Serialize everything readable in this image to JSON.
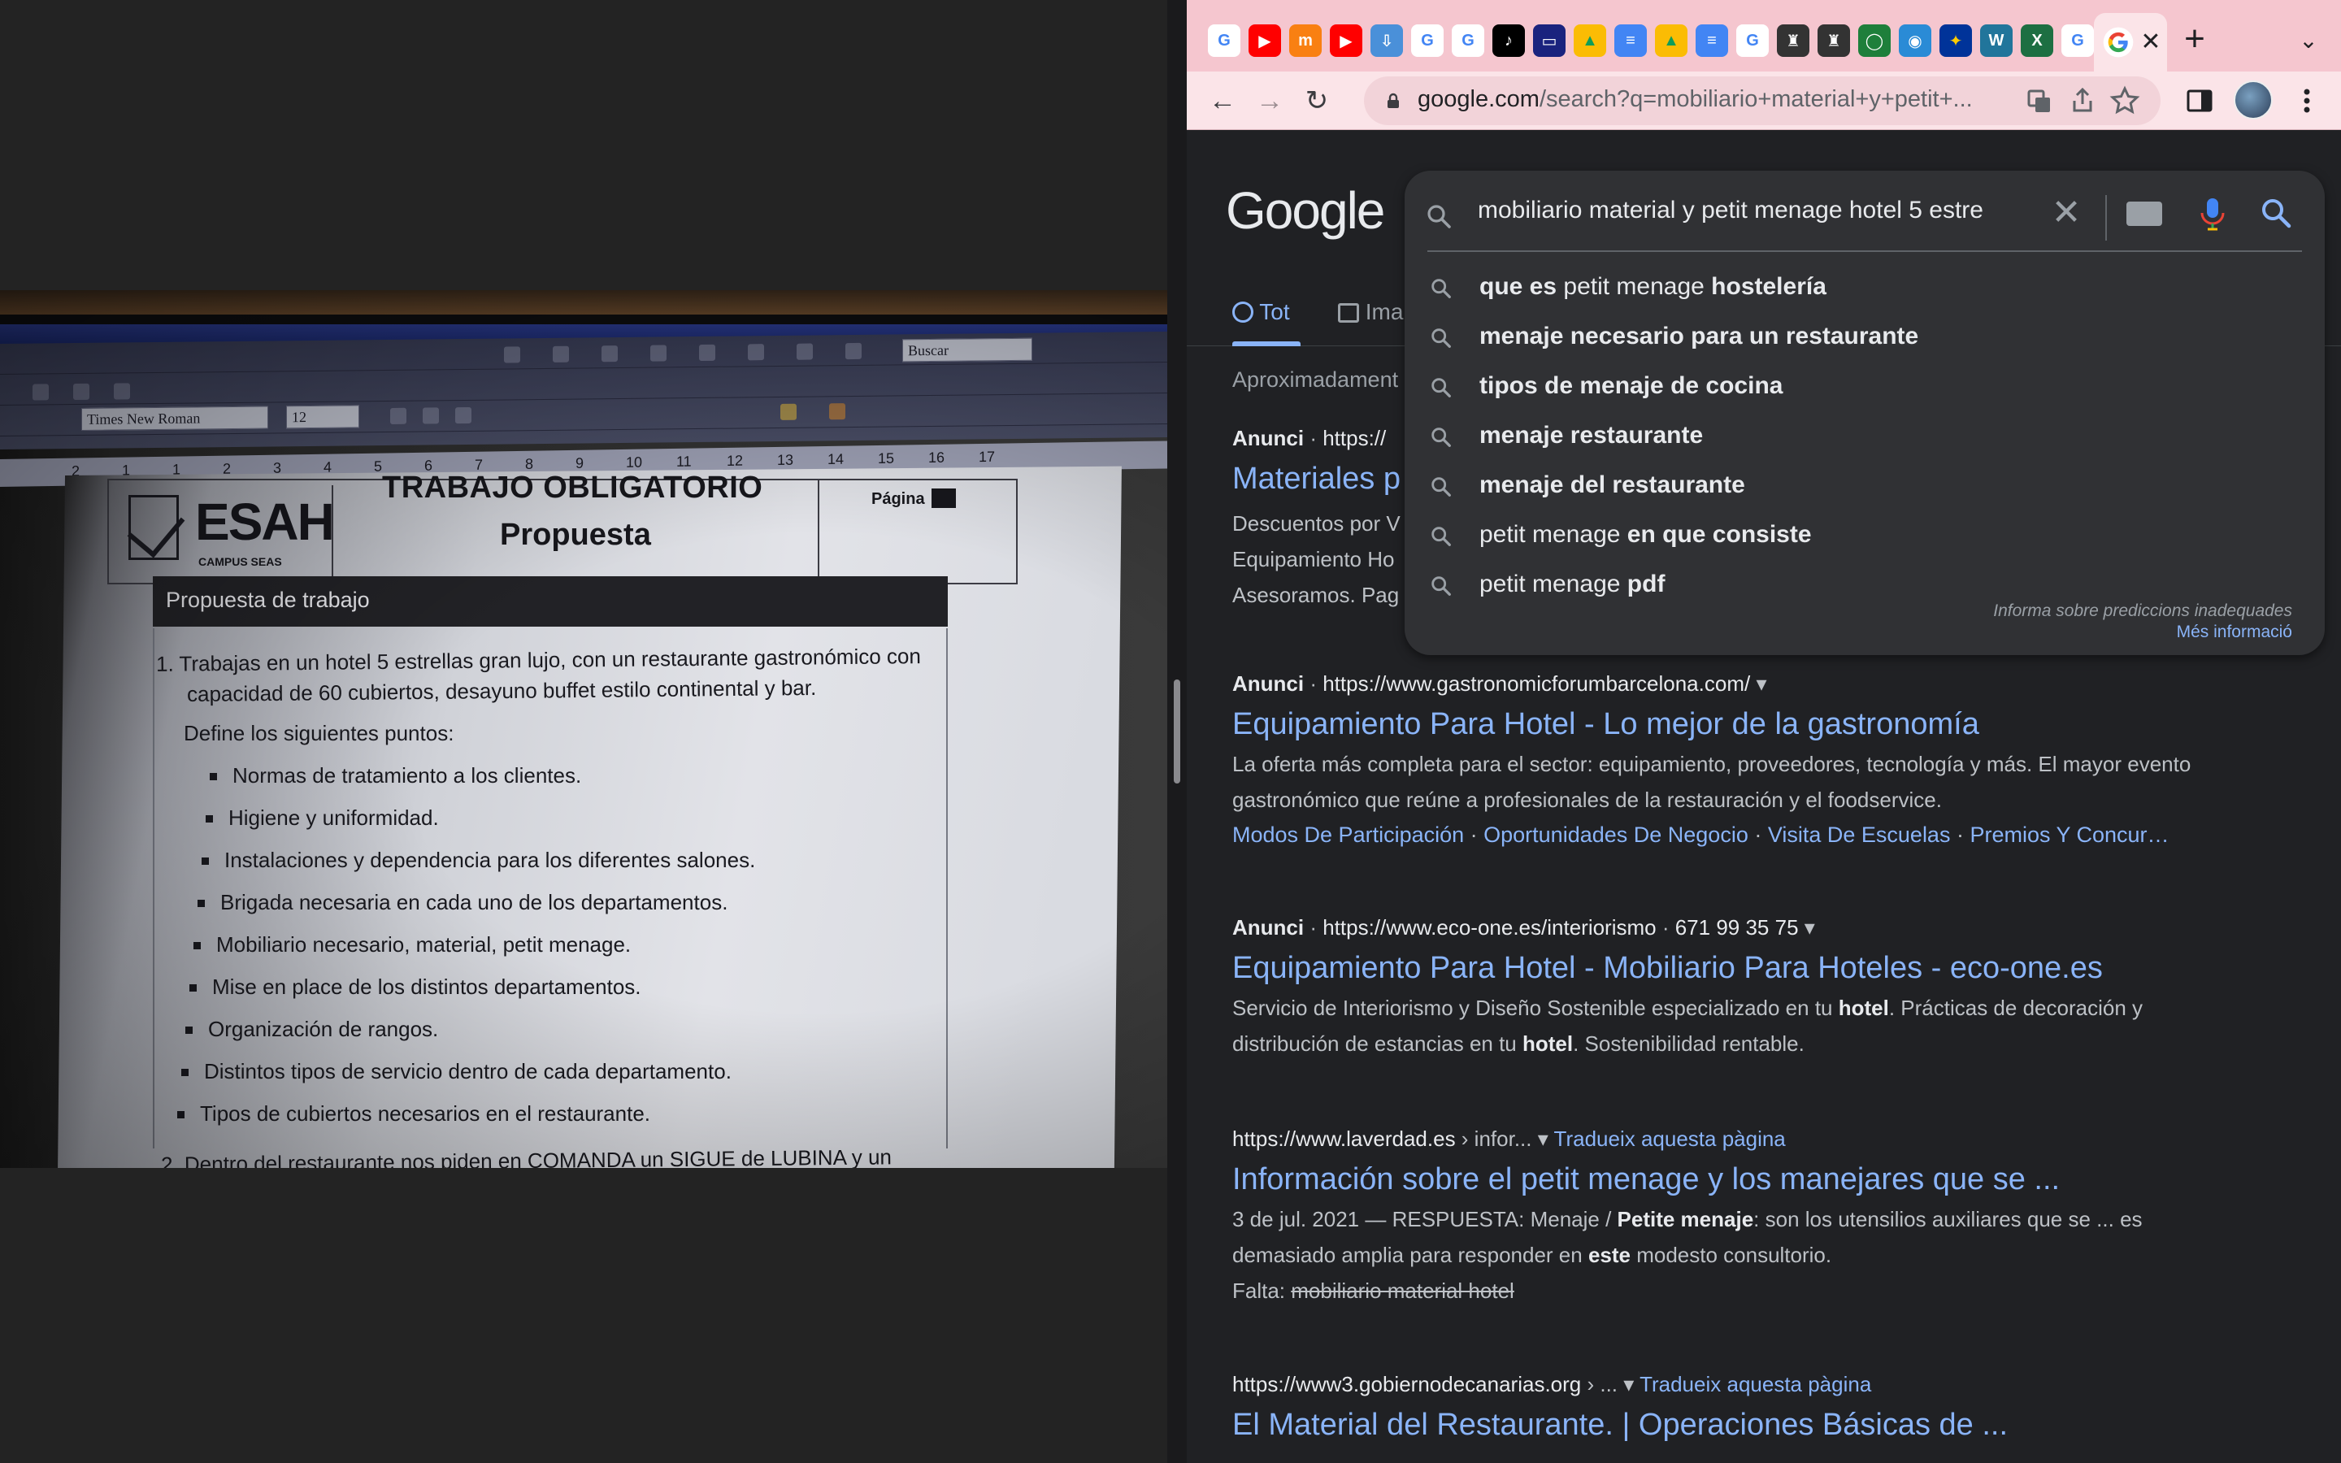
{
  "left_photo": {
    "toolbar_search_placeholder": "Buscar",
    "font_name": "Times New Roman",
    "font_size": "12",
    "ruler_numbers": [
      "2",
      "1",
      "1",
      "2",
      "3",
      "4",
      "5",
      "6",
      "7",
      "8",
      "9",
      "10",
      "11",
      "12",
      "13",
      "14",
      "15",
      "16",
      "17"
    ],
    "doc": {
      "logo_brand": "ESAH",
      "logo_sub": "CAMPUS SEAS",
      "title": "TRABAJO OBLIGATORIO",
      "subtitle": "Propuesta",
      "page_label": "Página",
      "band_heading": "Propuesta de trabajo",
      "item1_line1": "1.  Trabajas en un hotel 5 estrellas gran lujo, con un restaurante gastronómico con",
      "item1_line2": "capacidad de 60 cubiertos, desayuno buffet estilo continental y bar.",
      "define_intro": "Define los siguientes puntos:",
      "bullets": [
        "Normas de tratamiento a los clientes.",
        "Higiene y uniformidad.",
        "Instalaciones y dependencia para los diferentes salones.",
        "Brigada necesaria en cada uno de los departamentos.",
        "Mobiliario necesario, material, petit menage.",
        "Mise en place de los distintos departamentos.",
        "Organización de rangos.",
        "Distintos tipos de servicio dentro de cada departamento.",
        "Tipos de cubiertos necesarios en el restaurante."
      ],
      "item2_partial": "2.  Dentro del restaurante nos piden en COMANDA un SIGUE de LUBINA y un"
    }
  },
  "browser": {
    "tab_close_label": "✕",
    "new_tab_label": "+",
    "tab_list_label": "⌄",
    "back_label": "←",
    "forward_label": "→",
    "reload_label": "↻",
    "url_domain": "google.com",
    "url_path": "/search?q=mobiliario+material+y+petit+...",
    "favicons": [
      {
        "name": "google",
        "color": "#ffffff",
        "glyph": "G",
        "fg": "#4285f4"
      },
      {
        "name": "youtube",
        "color": "#ff0000",
        "glyph": "▶",
        "fg": "#ffffff"
      },
      {
        "name": "moodle",
        "color": "#f98012",
        "glyph": "m",
        "fg": "#ffffff"
      },
      {
        "name": "youtube",
        "color": "#ff0000",
        "glyph": "▶",
        "fg": "#ffffff"
      },
      {
        "name": "cloud-download",
        "color": "#4a90d9",
        "glyph": "⇩",
        "fg": "#ffffff"
      },
      {
        "name": "google",
        "color": "#ffffff",
        "glyph": "G",
        "fg": "#4285f4"
      },
      {
        "name": "google",
        "color": "#ffffff",
        "glyph": "G",
        "fg": "#4285f4"
      },
      {
        "name": "tiktok",
        "color": "#000000",
        "glyph": "♪",
        "fg": "#ffffff"
      },
      {
        "name": "screen",
        "color": "#1a237e",
        "glyph": "▭",
        "fg": "#ffffff"
      },
      {
        "name": "drive",
        "color": "#fbbc04",
        "glyph": "▲",
        "fg": "#0f9d58"
      },
      {
        "name": "docs",
        "color": "#4285f4",
        "glyph": "≡",
        "fg": "#ffffff"
      },
      {
        "name": "drive",
        "color": "#fbbc04",
        "glyph": "▲",
        "fg": "#0f9d58"
      },
      {
        "name": "docs",
        "color": "#4285f4",
        "glyph": "≡",
        "fg": "#ffffff"
      },
      {
        "name": "google",
        "color": "#ffffff",
        "glyph": "G",
        "fg": "#4285f4"
      },
      {
        "name": "castle",
        "color": "#333333",
        "glyph": "♜",
        "fg": "#ffffff"
      },
      {
        "name": "castle",
        "color": "#333333",
        "glyph": "♜",
        "fg": "#ffffff"
      },
      {
        "name": "circle-app",
        "color": "#1e7f3b",
        "glyph": "◯",
        "fg": "#ffffff"
      },
      {
        "name": "location",
        "color": "#2a8bd6",
        "glyph": "◉",
        "fg": "#ffffff"
      },
      {
        "name": "eu-flag",
        "color": "#003399",
        "glyph": "✦",
        "fg": "#ffcc00"
      },
      {
        "name": "wordpress",
        "color": "#21759b",
        "glyph": "W",
        "fg": "#ffffff"
      },
      {
        "name": "excel",
        "color": "#1d6f42",
        "glyph": "X",
        "fg": "#ffffff"
      },
      {
        "name": "google",
        "color": "#ffffff",
        "glyph": "G",
        "fg": "#4285f4"
      }
    ]
  },
  "google": {
    "logo": "Google",
    "query": "mobiliario material y petit menage hotel 5 estre",
    "suggestions": [
      {
        "pre": "que es",
        "plain": " petit menage ",
        "post": "hostelería"
      },
      {
        "pre": "menaje necesario para un restaurante",
        "plain": "",
        "post": ""
      },
      {
        "pre": "tipos de menaje de cocina",
        "plain": "",
        "post": ""
      },
      {
        "pre": "menaje restaurante",
        "plain": "",
        "post": ""
      },
      {
        "pre": "menaje del restaurante",
        "plain": "",
        "post": ""
      },
      {
        "pre": "",
        "plain": "petit menage ",
        "post": "en que consiste"
      },
      {
        "pre": "",
        "plain": "petit menage ",
        "post": "pdf"
      }
    ],
    "report_text": "Informa sobre prediccions inadequades",
    "more_info": "Més informació",
    "tab_all": "Tot",
    "tab_images": "Ima",
    "result_stats": "Aproximadament",
    "results": [
      {
        "ad": "Anunci",
        "url": "https://",
        "title": "Materiales p",
        "desc_lines": [
          "Descuentos por V",
          "Equipamiento Ho",
          "Asesoramos. Pag"
        ]
      },
      {
        "ad": "Anunci",
        "url": "https://www.gastronomicforumbarcelona.com/",
        "title": "Equipamiento Para Hotel - Lo mejor de la gastronomía",
        "desc": "La oferta más completa para el sector: equipamiento, proveedores, tecnología y más. El mayor evento gastronómico que reúne a profesionales de la restauración y el foodservice.",
        "sitelinks": [
          "Modos De Participación",
          "Oportunidades De Negocio",
          "Visita De Escuelas",
          "Premios Y Concur…"
        ]
      },
      {
        "ad": "Anunci",
        "url": "https://www.eco-one.es/interiorismo",
        "phone": "671 99 35 75",
        "title": "Equipamiento Para Hotel - Mobiliario Para Hoteles - eco-one.es",
        "desc_a": "Servicio de Interiorismo y Diseño Sostenible especializado en tu ",
        "desc_b": "hotel",
        "desc_c": ". Prácticas de decoración y distribución de estancias en tu ",
        "desc_d": "hotel",
        "desc_e": ". Sostenibilidad rentable."
      },
      {
        "url": "https://www.laverdad.es",
        "crumb": " › infor...",
        "translate": "Tradueix aquesta pàgina",
        "title": "Información sobre el petit menage y los manejares que se ...",
        "desc_a": "3 de jul. 2021 — RESPUESTA: Menaje / ",
        "desc_b": "Petite menaje",
        "desc_c": ": son los utensilios auxiliares que se ... es demasiado amplia para responder en ",
        "desc_d": "este",
        "desc_e": " modesto consultorio.",
        "missing_label": "Falta: ",
        "missing_terms": "mobiliario material hotel"
      },
      {
        "url": "https://www3.gobiernodecanarias.org",
        "crumb": " › ...",
        "translate": "Tradueix aquesta pàgina",
        "title": "El Material del Restaurante. | Operaciones Básicas de ..."
      }
    ]
  }
}
